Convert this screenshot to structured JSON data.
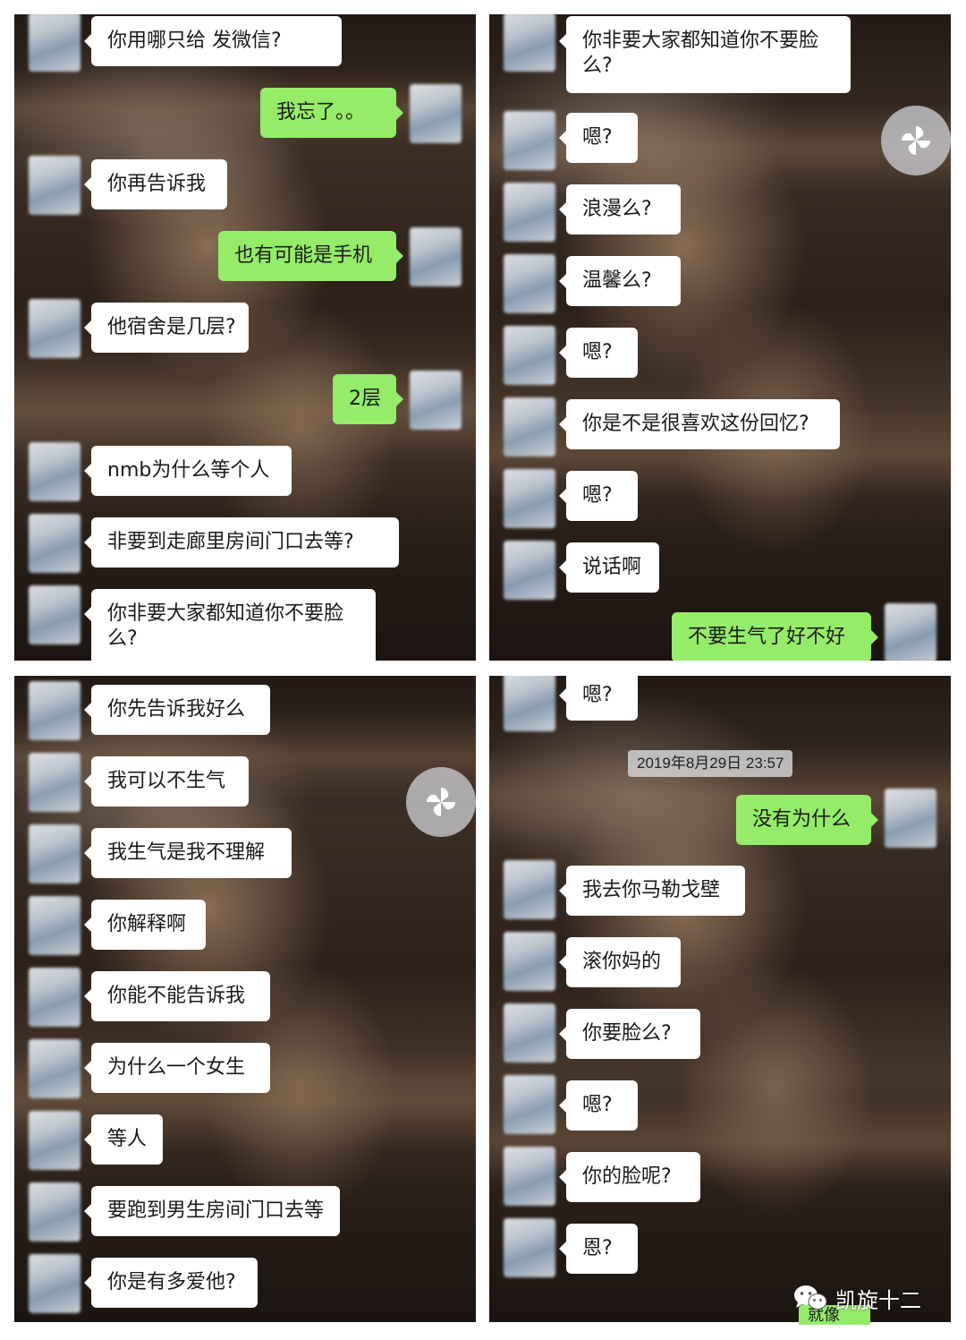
{
  "panels": {
    "top_left": {
      "messages": [
        {
          "side": "in",
          "text": "你用哪只给 发微信?"
        },
        {
          "side": "out",
          "text": "我忘了。。"
        },
        {
          "side": "in",
          "text": "你再告诉我"
        },
        {
          "side": "out",
          "text": "也有可能是手机"
        },
        {
          "side": "in",
          "text": "他宿舍是几层?"
        },
        {
          "side": "out",
          "text": "2层"
        },
        {
          "side": "in",
          "text": "nmb为什么等个人"
        },
        {
          "side": "in",
          "text": "非要到走廊里房间门口去等?"
        },
        {
          "side": "in",
          "text": "你非要大家都知道你不要脸么?"
        }
      ]
    },
    "top_right": {
      "messages": [
        {
          "side": "in",
          "text": "你非要大家都知道你不要脸么?"
        },
        {
          "side": "in",
          "text": "嗯?"
        },
        {
          "side": "in",
          "text": "浪漫么?"
        },
        {
          "side": "in",
          "text": "温馨么?"
        },
        {
          "side": "in",
          "text": "嗯?"
        },
        {
          "side": "in",
          "text": "你是不是很喜欢这份回忆?"
        },
        {
          "side": "in",
          "text": "嗯?"
        },
        {
          "side": "in",
          "text": "说话啊"
        },
        {
          "side": "out",
          "text": "不要生气了好不好"
        }
      ]
    },
    "bottom_left": {
      "messages": [
        {
          "side": "in",
          "text": "你先告诉我好么"
        },
        {
          "side": "in",
          "text": "我可以不生气"
        },
        {
          "side": "in",
          "text": "我生气是我不理解"
        },
        {
          "side": "in",
          "text": "你解释啊"
        },
        {
          "side": "in",
          "text": "你能不能告诉我"
        },
        {
          "side": "in",
          "text": "为什么一个女生"
        },
        {
          "side": "in",
          "text": "等人"
        },
        {
          "side": "in",
          "text": "要跑到男生房间门口去等"
        },
        {
          "side": "in",
          "text": "你是有多爱他?"
        }
      ]
    },
    "bottom_right": {
      "timestamp": "2019年8月29日 23:57",
      "messages": [
        {
          "side": "in",
          "text": "嗯?"
        },
        {
          "side": "out",
          "text": "没有为什么"
        },
        {
          "side": "in",
          "text": "我去你马勒戈壁"
        },
        {
          "side": "in",
          "text": "滚你妈的"
        },
        {
          "side": "in",
          "text": "你要脸么?"
        },
        {
          "side": "in",
          "text": "嗯?"
        },
        {
          "side": "in",
          "text": "你的脸呢?"
        },
        {
          "side": "in",
          "text": "恩?"
        }
      ]
    }
  },
  "watermark": {
    "icon": "wechat-icon",
    "text": "凯旋十二"
  },
  "partial_bubble_text": "就像",
  "floating_button_icon": "pinwheel-icon",
  "colors": {
    "outgoing_bubble": "#95ec69",
    "incoming_bubble": "#ffffff"
  }
}
